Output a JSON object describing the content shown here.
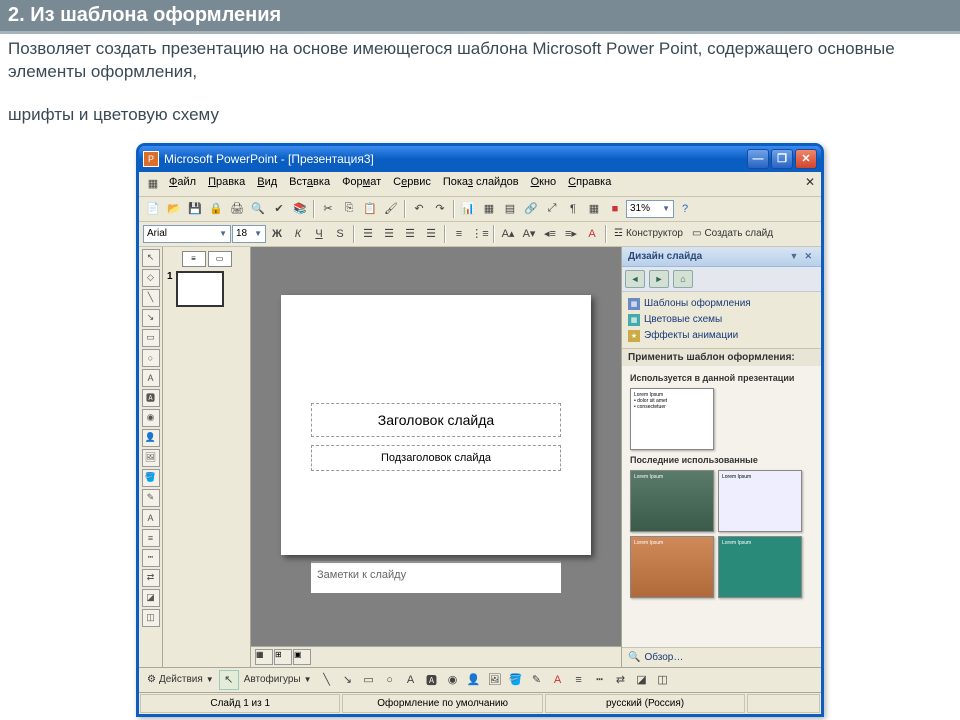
{
  "header": {
    "title": "2. Из шаблона оформления",
    "desc1": "Позволяет создать презентацию на основе имеющегося шаблона Microsoft Power Point, содержащего основные элементы оформления,",
    "desc2": "шрифты и цветовую схему"
  },
  "window": {
    "title": "Microsoft PowerPoint - [Презентация3]",
    "icon_letter": "P"
  },
  "menu": {
    "file": "Файл",
    "edit": "Правка",
    "view": "Вид",
    "insert": "Вставка",
    "format": "Формат",
    "tools": "Сервис",
    "slideshow": "Показ слайдов",
    "window": "Окно",
    "help": "Справка"
  },
  "toolbar1": {
    "zoom": "31%"
  },
  "toolbar2": {
    "font": "Arial",
    "size": "18",
    "bold": "Ж",
    "italic": "К",
    "underline": "Ч",
    "shadow": "S",
    "designer": "Конструктор",
    "newslide": "Создать слайд"
  },
  "thumb": {
    "num": "1"
  },
  "slide": {
    "title_ph": "Заголовок слайда",
    "subtitle_ph": "Подзаголовок слайда"
  },
  "notes": "Заметки к слайду",
  "taskpane": {
    "title": "Дизайн слайда",
    "link1": "Шаблоны оформления",
    "link2": "Цветовые схемы",
    "link3": "Эффекты анимации",
    "apply": "Применить шаблон оформления:",
    "used": "Используется в данной презентации",
    "recent": "Последние использованные",
    "browse": "Обзор…"
  },
  "drawbar": {
    "actions": "Действия",
    "autoshapes": "Автофигуры"
  },
  "status": {
    "slide": "Слайд 1 из 1",
    "design": "Оформление по умолчанию",
    "lang": "русский (Россия)"
  }
}
